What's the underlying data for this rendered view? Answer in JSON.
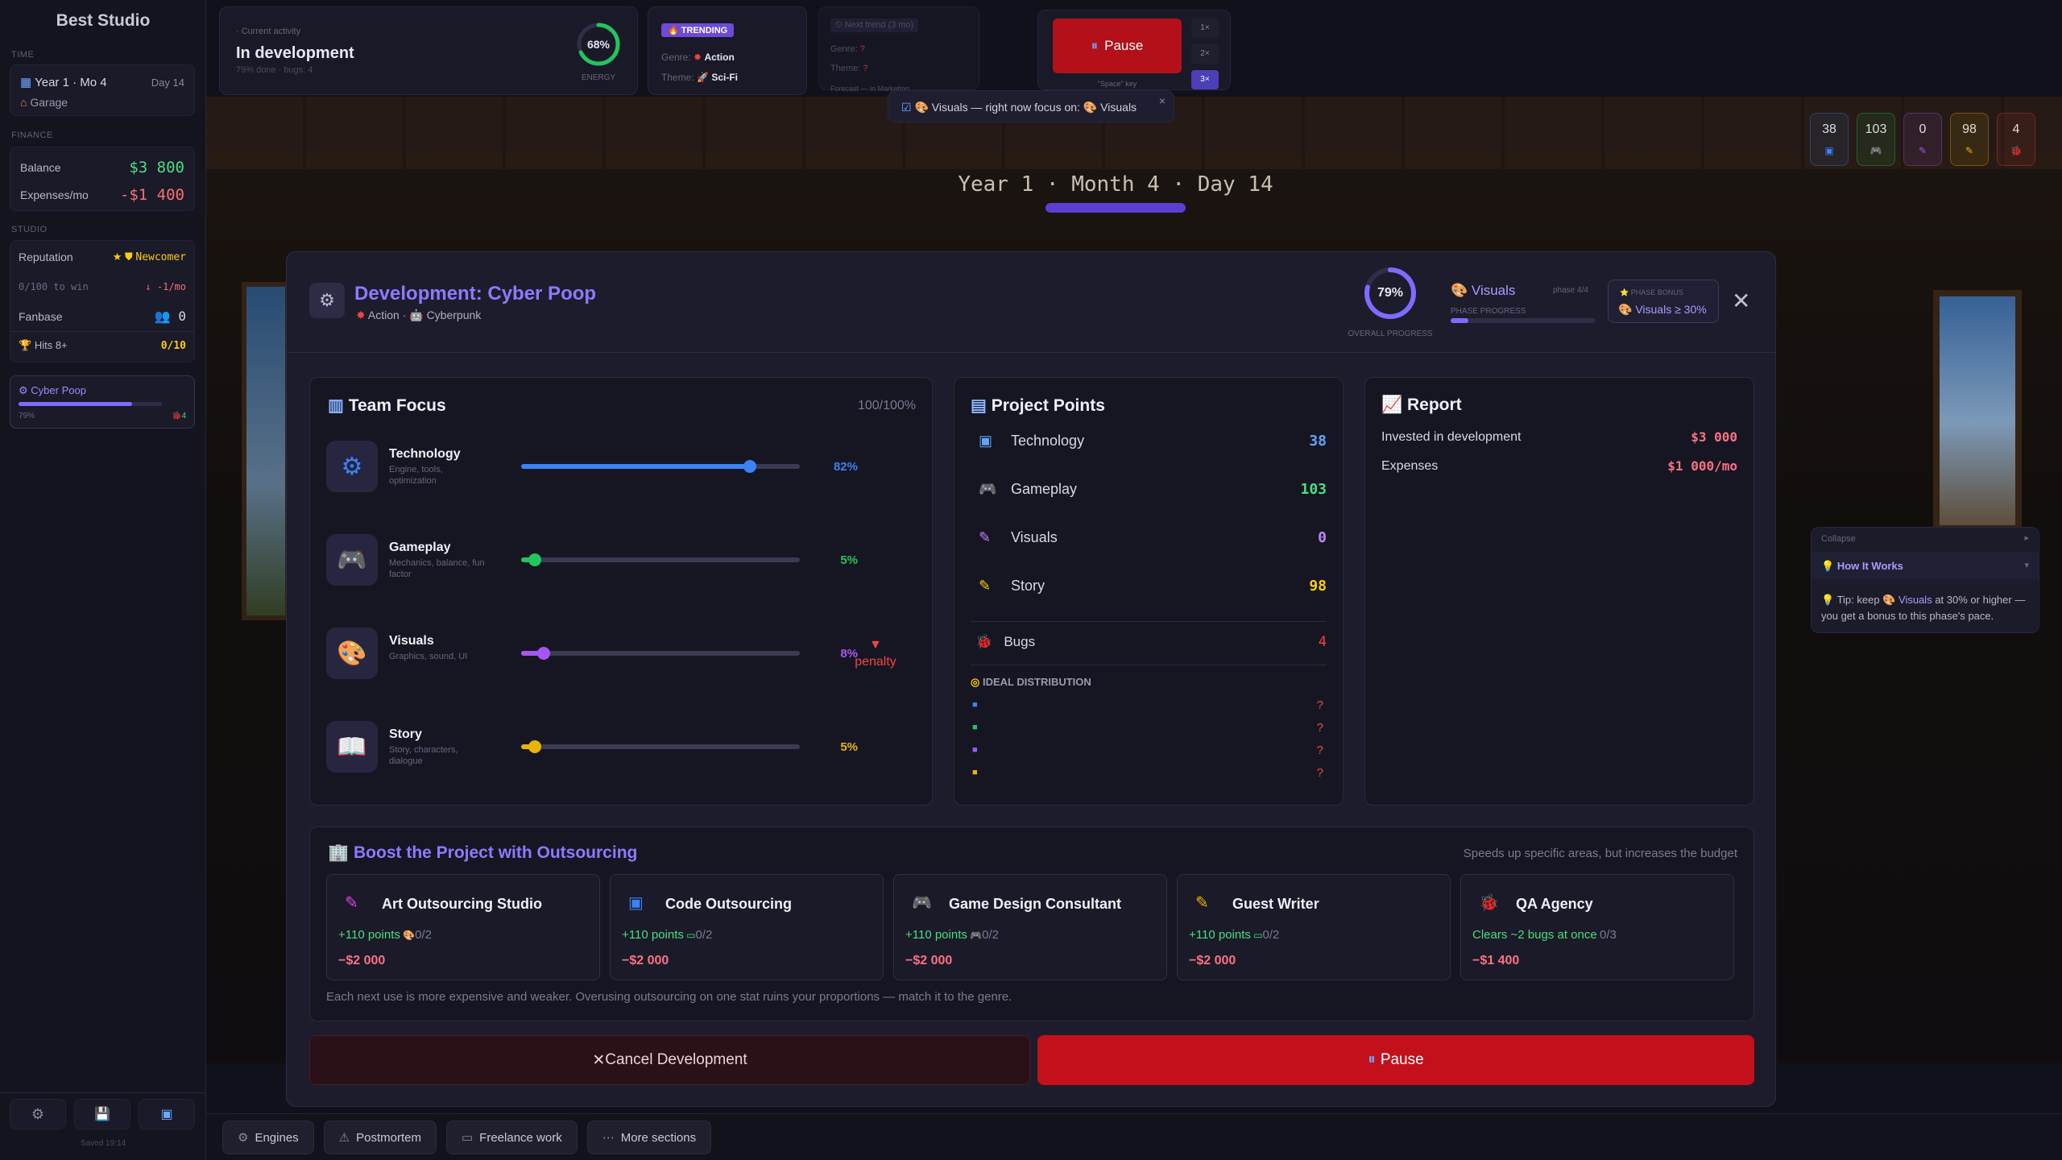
{
  "sidebar": {
    "brand": "Best Studio",
    "time_h": "Time",
    "date": "Year 1 · Mo 4",
    "day": "Day 14",
    "location": "Garage",
    "finance_h": "Finance",
    "balance_label": "Balance",
    "balance": "$3 800",
    "expenses_label": "Expenses/mo",
    "expenses": "-$1 400",
    "studio_h": "Studio",
    "reputation_label": "Reputation",
    "reputation": "Newcomer",
    "rep_progress": "0/100 to win",
    "rep_rate": "↓ -1/mo",
    "fanbase_label": "Fanbase",
    "fanbase": "0",
    "hits_label": "Hits 8+",
    "hits": "0/10",
    "project_name": "Cyber Poop",
    "project_pct": "79%",
    "project_bugs": "4",
    "project_progress": 0.79,
    "saved": "Saved 19:14"
  },
  "topbar": {
    "activity_h": "· Current activity",
    "activity": "In development",
    "activity_sub": "79% done · bugs: 4",
    "energy": "68%",
    "energy_label": "Energy",
    "energy_value": 0.68,
    "trending_h": "Trending",
    "genre_label": "Genre:",
    "genre": "Action",
    "theme_label": "Theme:",
    "theme": "Sci-Fi",
    "next_h": "Next trend (3 mo)",
    "next_genre": "?",
    "next_theme": "?",
    "forecast": "Forecast — in Marketing",
    "pause": "Pause",
    "speed": [
      "1×",
      "2×",
      "3×"
    ],
    "space_key": "\"Space\" key",
    "toast": "Visuals — right now focus on:",
    "toast_focus": "Visuals"
  },
  "stats": [
    {
      "v": "38",
      "color": "#3b82f6"
    },
    {
      "v": "103",
      "color": "#22c55e"
    },
    {
      "v": "0",
      "color": "#a855f7"
    },
    {
      "v": "98",
      "color": "#eab308"
    },
    {
      "v": "4",
      "color": "#ef4444"
    }
  ],
  "date_banner": "Year 1 · Month 4 · Day 14",
  "modal": {
    "title": "Development: Cyber Poop",
    "genre": "Action",
    "theme": "Cyberpunk",
    "overall": "79%",
    "overall_label": "Overall progress",
    "overall_value": 0.79,
    "phase": "Visuals",
    "phase_num": "phase 4/4",
    "phase_label": "Phase progress",
    "phase_progress": 0.12,
    "bonus_h": "Phase bonus",
    "bonus": "Visuals ≥ 30%"
  },
  "team_focus": {
    "title": "Team Focus",
    "total": "100/100%",
    "items": [
      {
        "name": "Technology",
        "desc1": "Engine, tools,",
        "desc2": "optimization",
        "pct": "82%",
        "value": 0.82,
        "color": "#3b82f6"
      },
      {
        "name": "Gameplay",
        "desc1": "Mechanics, balance, fun",
        "desc2": "factor",
        "pct": "5%",
        "value": 0.05,
        "color": "#22c55e"
      },
      {
        "name": "Visuals",
        "desc1": "Graphics, sound, UI",
        "desc2": "",
        "pct": "8%",
        "value": 0.08,
        "color": "#a855f7"
      },
      {
        "name": "Story",
        "desc1": "Story, characters,",
        "desc2": "dialogue",
        "pct": "5%",
        "value": 0.05,
        "color": "#eab308"
      }
    ],
    "penalty": "penalty"
  },
  "project_points": {
    "title": "Project Points",
    "items": [
      {
        "name": "Technology",
        "v": "38",
        "color": "#60a5fa"
      },
      {
        "name": "Gameplay",
        "v": "103",
        "color": "#4ade80"
      },
      {
        "name": "Visuals",
        "v": "0",
        "color": "#c084fc"
      },
      {
        "name": "Story",
        "v": "98",
        "color": "#facc15"
      }
    ],
    "bugs_label": "Bugs",
    "bugs": "4",
    "ideal_h": "Ideal distribution",
    "ideal": [
      "?",
      "?",
      "?",
      "?"
    ]
  },
  "report": {
    "title": "Report",
    "invested_label": "Invested in development",
    "invested": "$3 000",
    "expenses_label": "Expenses",
    "expenses": "$1 000/mo"
  },
  "outsourcing": {
    "title": "Boost the Project with Outsourcing",
    "subtitle": "Speeds up specific areas, but increases the budget",
    "items": [
      {
        "name": "Art Outsourcing Studio",
        "gain": "+110 points",
        "count": "0/2",
        "cost": "−$2 000"
      },
      {
        "name": "Code Outsourcing",
        "gain": "+110 points",
        "count": "0/2",
        "cost": "−$2 000"
      },
      {
        "name": "Game Design Consultant",
        "gain": "+110 points",
        "count": "0/2",
        "cost": "−$2 000"
      },
      {
        "name": "Guest Writer",
        "gain": "+110 points",
        "count": "0/2",
        "cost": "−$2 000"
      },
      {
        "name": "QA Agency",
        "gain": "Clears ~2 bugs at once",
        "count": "0/3",
        "cost": "−$1 400"
      }
    ],
    "note": "Each next use is more expensive and weaker. Overusing outsourcing on one stat ruins your proportions — match it to the genre."
  },
  "actions": {
    "cancel": "Cancel Development",
    "pause": "Pause"
  },
  "help": {
    "collapse": "Collapse",
    "how": "How It Works",
    "tip1": "Tip: keep",
    "tip_focus": "Visuals",
    "tip2": "at 30% or higher — you get a bonus to this phase's pace."
  },
  "bottom": [
    {
      "label": "Engines",
      "icon": "⚙"
    },
    {
      "label": "Postmortem",
      "icon": "⚠"
    },
    {
      "label": "Freelance work",
      "icon": "▭"
    },
    {
      "label": "More sections",
      "icon": "⋯"
    }
  ]
}
